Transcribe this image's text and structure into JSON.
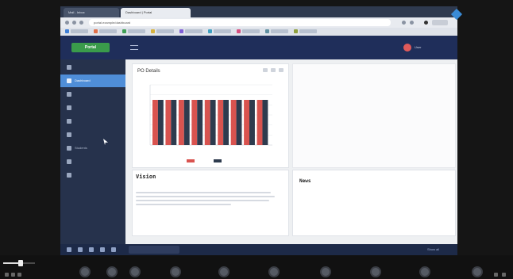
{
  "browser": {
    "tabs": [
      {
        "label": "Mail - Inbox"
      },
      {
        "label": "Dashboard | Portal"
      }
    ],
    "url": "portal.example/dashboard",
    "bookmarks": [
      "",
      "",
      "",
      "",
      "",
      "",
      "",
      "",
      ""
    ]
  },
  "app": {
    "logo_text": "Portal",
    "user_name": "User",
    "sidebar": {
      "items": [
        {
          "label": "",
          "active": false
        },
        {
          "label": "Dashboard",
          "active": true
        },
        {
          "label": "",
          "active": false
        },
        {
          "label": "",
          "active": false
        },
        {
          "label": "",
          "active": false
        },
        {
          "label": "",
          "active": false
        },
        {
          "label": "Students",
          "active": false
        },
        {
          "label": "",
          "active": false
        },
        {
          "label": "",
          "active": false
        }
      ]
    },
    "panel": {
      "title": "PO Details",
      "subtitle": ""
    },
    "vision": {
      "title": "Vision",
      "subtitle": ""
    },
    "news": {
      "title": "News"
    },
    "footer": "",
    "taskbar": {
      "downloads": [
        ""
      ],
      "show_all": "Show all"
    }
  },
  "overlay": {
    "menu": [
      "",
      "",
      "",
      ""
    ],
    "timecode": "",
    "progress": 0.55
  },
  "colors": {
    "series_a": "#d9534f",
    "series_b": "#2e3b4e",
    "sidebar_active": "#4f8ed8"
  },
  "chart_data": {
    "type": "bar",
    "categories": [
      "",
      "",
      "",
      "",
      "",
      "",
      "",
      "",
      ""
    ],
    "series": [
      {
        "name": "",
        "values": [
          90,
          90,
          90,
          90,
          90,
          90,
          90,
          90,
          90
        ]
      },
      {
        "name": "",
        "values": [
          90,
          90,
          90,
          90,
          90,
          90,
          90,
          90,
          90
        ]
      }
    ],
    "ylim": [
      0,
      120
    ],
    "grid": true,
    "legend": "bottom"
  }
}
